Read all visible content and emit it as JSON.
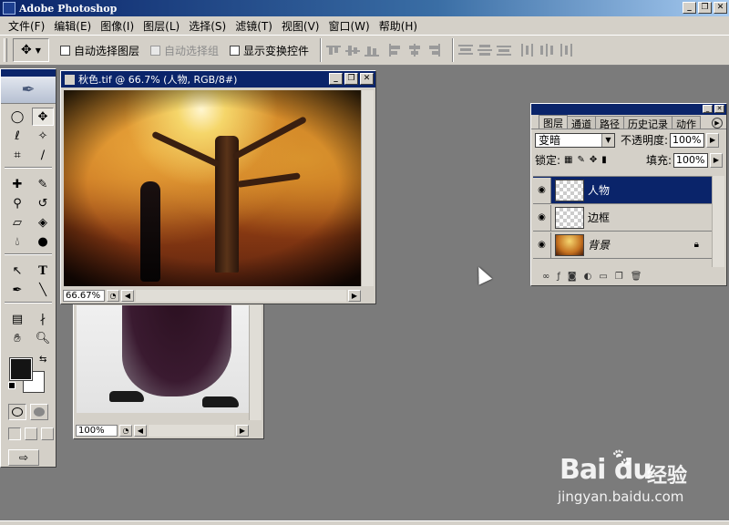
{
  "app": {
    "title": "Adobe Photoshop"
  },
  "window_controls": {
    "minimize": "_",
    "restore": "❐",
    "close": "✕"
  },
  "menu": [
    "文件(F)",
    "编辑(E)",
    "图像(I)",
    "图层(L)",
    "选择(S)",
    "滤镜(T)",
    "视图(V)",
    "窗口(W)",
    "帮助(H)"
  ],
  "options": {
    "auto_select_layer": "自动选择图层",
    "auto_select_group": "自动选择组",
    "show_transform": "显示变换控件"
  },
  "doc_autumn": {
    "title": "秋色.tif @ 66.7% (人物, RGB/8#)",
    "zoom": "66.67%"
  },
  "doc_woman": {
    "zoom": "100%"
  },
  "layers_panel": {
    "tabs": [
      "图层",
      "通道",
      "路径",
      "历史记录",
      "动作"
    ],
    "blend_mode": "变暗",
    "opacity_label": "不透明度:",
    "opacity_value": "100%",
    "lock_label": "锁定:",
    "fill_label": "填充:",
    "fill_value": "100%",
    "layers": [
      {
        "name": "人物",
        "selected": true
      },
      {
        "name": "边框",
        "selected": false
      },
      {
        "name": "背景",
        "selected": false
      }
    ]
  },
  "watermark": {
    "brand": "Bai du",
    "product": "经验",
    "url": "jingyan.baidu.com"
  },
  "colors": {
    "title_active": "#0a246a",
    "chrome": "#d4d0c8",
    "workspace": "#7b7b7b",
    "foreground": "#141414",
    "background": "#ffffff"
  }
}
